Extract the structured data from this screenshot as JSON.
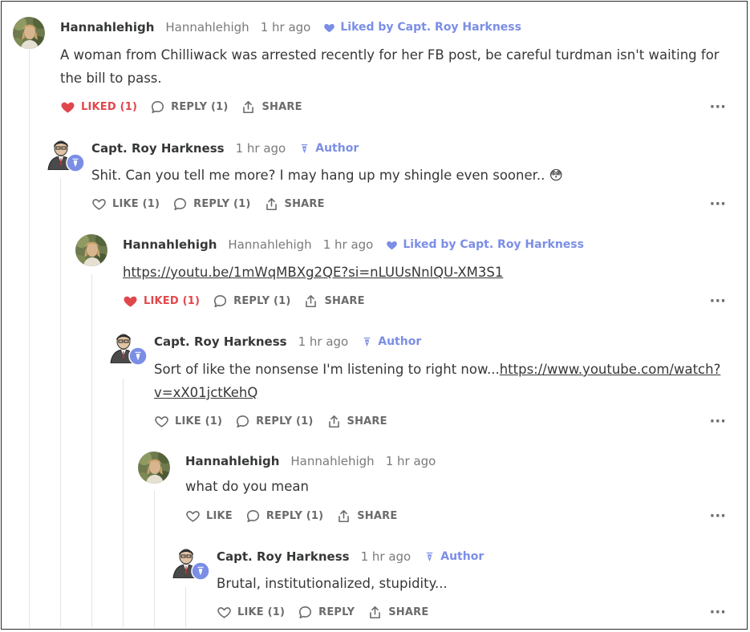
{
  "colors": {
    "accent": "#7b8ee6",
    "liked": "#e0474c",
    "text": "#363737",
    "muted": "#7a7a7a"
  },
  "comments": [
    {
      "name": "Hannahlehigh",
      "handle": "Hannahlehigh",
      "time": "1 hr ago",
      "badge": "Liked by Capt. Roy Harkness",
      "badge_icon": "heart-icon",
      "body": "A woman from Chilliwack was arrested recently for her FB post, be careful turdman isn't waiting for the bill to pass.",
      "like": "LIKED (1)",
      "liked": true,
      "reply": "REPLY (1)",
      "share": "SHARE",
      "more": "···"
    },
    {
      "name": "Capt. Roy Harkness",
      "time": "1 hr ago",
      "badge": "Author",
      "badge_icon": "pen-nib-icon",
      "body": "Shit. Can you tell me more? I may hang up my shingle even sooner.. 😳",
      "like": "LIKE (1)",
      "liked": false,
      "reply": "REPLY (1)",
      "share": "SHARE",
      "more": "···"
    },
    {
      "name": "Hannahlehigh",
      "handle": "Hannahlehigh",
      "time": "1 hr ago",
      "badge": "Liked by Capt. Roy Harkness",
      "badge_icon": "heart-icon",
      "body_link": "https://youtu.be/1mWqMBXg2QE?si=nLUUsNnlQU-XM3S1",
      "like": "LIKED (1)",
      "liked": true,
      "reply": "REPLY (1)",
      "share": "SHARE",
      "more": "···"
    },
    {
      "name": "Capt. Roy Harkness",
      "time": "1 hr ago",
      "badge": "Author",
      "badge_icon": "pen-nib-icon",
      "body_text": "Sort of like the nonsense I'm listening to right now...",
      "body_link_1": "https://www.youtube.com/watch?",
      "body_link_2": "v=xX01jctKehQ",
      "like": "LIKE (1)",
      "liked": false,
      "reply": "REPLY (1)",
      "share": "SHARE",
      "more": "···"
    },
    {
      "name": "Hannahlehigh",
      "handle": "Hannahlehigh",
      "time": "1 hr ago",
      "body": "what do you mean",
      "like": "LIKE",
      "liked": false,
      "reply": "REPLY (1)",
      "share": "SHARE",
      "more": "···"
    },
    {
      "name": "Capt. Roy Harkness",
      "time": "1 hr ago",
      "badge": "Author",
      "badge_icon": "pen-nib-icon",
      "body": "Brutal, institutionalized, stupidity...",
      "like": "LIKE (1)",
      "liked": false,
      "reply": "REPLY",
      "share": "SHARE",
      "more": "···"
    }
  ]
}
